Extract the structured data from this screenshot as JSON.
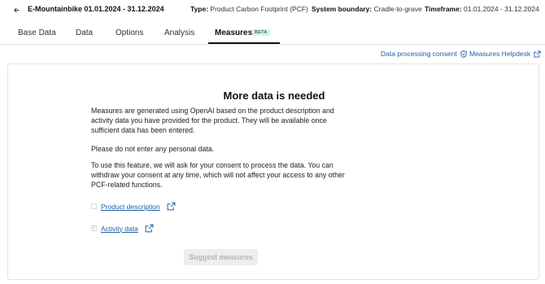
{
  "header": {
    "back_icon": "arrow-left-icon",
    "product_title": "E-Mountainbike 01.01.2024 - 31.12.2024",
    "type_label": "Type:",
    "type_value": "Product Carbon Footprint (PCF)",
    "boundary_label": "System boundary:",
    "boundary_value": "Cradle-to-grave",
    "timeframe_label": "Timeframe:",
    "timeframe_value": "01.01.2024 - 31.12.2024"
  },
  "tabs": [
    {
      "label": "Base Data"
    },
    {
      "label": "Data"
    },
    {
      "label": "Options"
    },
    {
      "label": "Analysis"
    },
    {
      "label": "Measures",
      "badge": "BETA",
      "active": true
    }
  ],
  "links": {
    "consent": "Data processing consent",
    "consent_icon": "shield-icon",
    "helpdesk": "Measures Helpdesk",
    "helpdesk_icon": "external-link-icon"
  },
  "card": {
    "title": "More data is needed",
    "paragraph_1": "Measures are generated using OpenAI based on the product description and activity data you have provided for the product. They will be available once sufficient data has been entered.",
    "paragraph_2": "Please do not enter any personal data.",
    "paragraph_3": "To use this feature, we will ask for your consent to process the data. You can withdraw your consent at any time, which will not affect your access to any other PCF-related functions.",
    "items": [
      {
        "label": "Product description",
        "checked": false
      },
      {
        "label": "Activity data",
        "checked": true
      }
    ],
    "button_label": "Suggest measures"
  },
  "colors": {
    "link": "#1f5fa8",
    "beta_text": "#1f7a66",
    "beta_bg": "#d8f2ea",
    "disabled_bg": "#eeeeee",
    "disabled_text": "#b3b3b3"
  }
}
